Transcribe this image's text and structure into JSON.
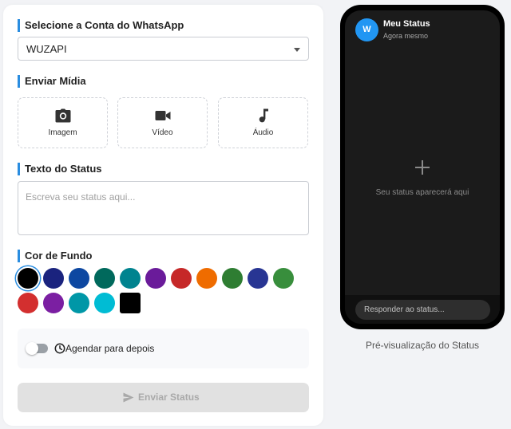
{
  "account": {
    "title": "Selecione a Conta do WhatsApp",
    "selected": "WUZAPI"
  },
  "media": {
    "title": "Enviar Mídia",
    "buttons": [
      {
        "label": "Imagem",
        "icon": "camera-icon"
      },
      {
        "label": "Vídeo",
        "icon": "video-icon"
      },
      {
        "label": "Áudio",
        "icon": "music-note-icon"
      }
    ]
  },
  "status_text": {
    "title": "Texto do Status",
    "placeholder": "Escreva seu status aqui..."
  },
  "background": {
    "title": "Cor de Fundo",
    "colors": [
      "#000000",
      "#1a237e",
      "#0d47a1",
      "#00695c",
      "#00838f",
      "#6a1b9a",
      "#c62828",
      "#ef6c00",
      "#2e7d32",
      "#283593",
      "#388e3c",
      "#d32f2f",
      "#7b1fa2",
      "#0097a7",
      "#00bcd4",
      "#000000"
    ],
    "selected_index": 0
  },
  "schedule": {
    "label": "Agendar para depois",
    "enabled": false
  },
  "send": {
    "label": "Enviar Status"
  },
  "preview": {
    "avatar_letter": "W",
    "title": "Meu Status",
    "time": "Agora mesmo",
    "empty_text": "Seu status aparecerá aqui",
    "reply_placeholder": "Responder ao status...",
    "caption": "Pré-visualização do Status"
  },
  "colors": {
    "accent": "#2a8de0",
    "avatar": "#2196f3"
  }
}
